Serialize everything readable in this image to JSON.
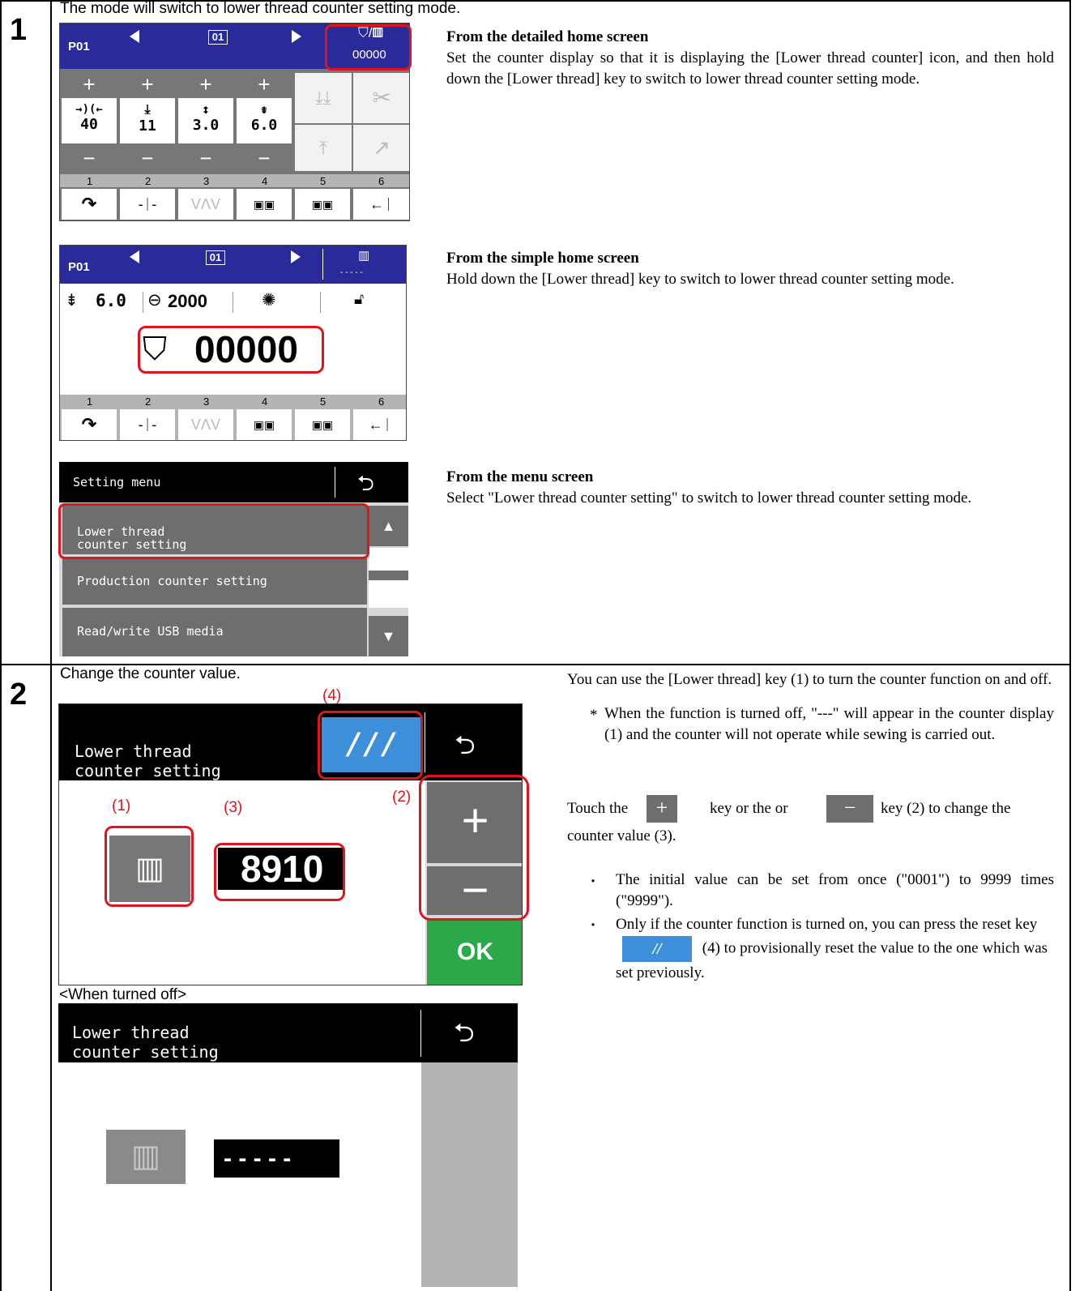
{
  "step1": {
    "number": "1",
    "intro": "The mode will switch to lower thread counter setting mode.",
    "detailed": {
      "heading": "From the detailed home screen",
      "body": "Set the counter display so that it is displaying the [Lower thread counter] icon, and then hold down the [Lower thread] key to switch to lower thread counter setting mode.",
      "screen": {
        "program": "P01",
        "pattern_no": "01",
        "counter_value": "00000",
        "params": [
          {
            "icon": "→)(←",
            "value": "40"
          },
          {
            "icon": "⤓",
            "value": "11"
          },
          {
            "icon": "↕",
            "value": "3.0"
          },
          {
            "icon": "⇟",
            "value": "6.0"
          }
        ],
        "plus": "+",
        "minus": "−",
        "key_numbers": [
          "1",
          "2",
          "3",
          "4",
          "5",
          "6"
        ]
      }
    },
    "simple": {
      "heading": "From the simple home screen",
      "body": "Hold down the [Lower thread] key to switch to lower thread counter setting mode.",
      "screen": {
        "program": "P01",
        "pattern_no": "01",
        "counter_dashes": "- - - - -",
        "stitch": "6.0",
        "speed": "2000",
        "big_counter": "00000",
        "key_numbers": [
          "1",
          "2",
          "3",
          "4",
          "5",
          "6"
        ]
      }
    },
    "menu": {
      "heading": "From the menu screen",
      "body": "Select \"Lower thread counter setting\" to switch to lower thread counter setting mode.",
      "screen": {
        "title": "Setting menu",
        "items": [
          "Lower thread\ncounter setting",
          "Production counter setting",
          "Read/write USB media"
        ]
      }
    }
  },
  "step2": {
    "number": "2",
    "intro": "Change the counter value.",
    "screen_on": {
      "title_line1": "Lower thread",
      "title_line2": "counter setting",
      "value": "8910",
      "ok": "OK",
      "plus": "+",
      "minus": "−",
      "callouts": {
        "c1": "(1)",
        "c2": "(2)",
        "c3": "(3)",
        "c4": "(4)"
      }
    },
    "off_label": "<When turned off>",
    "screen_off": {
      "title_line1": "Lower thread",
      "title_line2": "counter setting",
      "value": "- - - - -"
    },
    "text": {
      "p1": "You can use the [Lower thread] key (1) to turn the counter function on and off.",
      "note_star": "*",
      "note": "When the function is turned off, \"---\" will appear in the counter display (1) and the counter will not operate while sewing is carried out.",
      "touch_a": "Touch the",
      "touch_b": "key or the or",
      "touch_c": "key (2) to change the",
      "touch_d": "counter value (3).",
      "bullet_mark": "・",
      "bullet1": "The initial value can be set from once (\"0001\") to 9999 times (\"9999\").",
      "bullet2_a": "Only if the counter function is turned on, you can press the reset key",
      "bullet2_b": "(4) to provisionally reset the value to the one which was set previously."
    }
  },
  "colors": {
    "blue_bar": "#2a2a9a",
    "red": "#e0141e",
    "ok_green": "#2aa84a",
    "reset_blue": "#3c8fd8"
  }
}
